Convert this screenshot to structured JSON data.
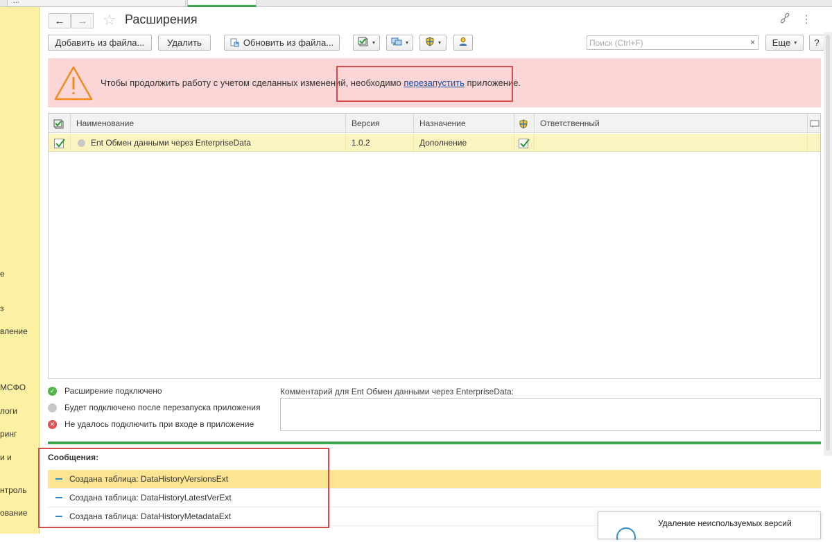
{
  "tabs": [
    {
      "label": "..."
    },
    {
      "label": ""
    }
  ],
  "sidebar": {
    "items": [
      "е",
      "з",
      "вление",
      "МСФО",
      "логи",
      "ринг",
      "и и",
      "нтроль",
      "ование"
    ]
  },
  "header": {
    "title": "Расширения"
  },
  "toolbar": {
    "add_from_file": "Добавить из файла...",
    "delete": "Удалить",
    "update_from_file": "Обновить из файла...",
    "search_placeholder": "Поиск (Ctrl+F)",
    "search_clear": "×",
    "more": "Еще",
    "help": "?"
  },
  "warning": {
    "text_before": "Чтобы продолжить работу с учетом сделанных изменений, необходимо ",
    "link": "перезапустить",
    "text_after": " приложение."
  },
  "table": {
    "columns": {
      "name": "Наименование",
      "version": "Версия",
      "purpose": "Назначение",
      "responsible": "Ответственный"
    },
    "rows": [
      {
        "name": "Ent Обмен данными через EnterpriseData",
        "version": "1.0.2",
        "purpose": "Дополнение",
        "responsible": ""
      }
    ]
  },
  "legend": {
    "connected": "Расширение подключено",
    "after_restart": "Будет подключено после перезапуска приложения",
    "failed": "Не удалось подключить при входе в приложение"
  },
  "comment": {
    "label": "Комментарий для Ent Обмен данными через EnterpriseData:",
    "value": ""
  },
  "messages": {
    "title": "Сообщения:",
    "items": [
      "Создана таблица: DataHistoryVersionsExt",
      "Создана таблица: DataHistoryLatestVerExt",
      "Создана таблица: DataHistoryMetadataExt"
    ]
  },
  "popup": {
    "text": "Удаление неиспользуемых версий"
  },
  "colors": {
    "accent_green": "#3da94f",
    "warning_bg": "#fbd6d7",
    "sidebar_bg": "#fcf0a2",
    "highlight_red": "#d34b4b"
  }
}
